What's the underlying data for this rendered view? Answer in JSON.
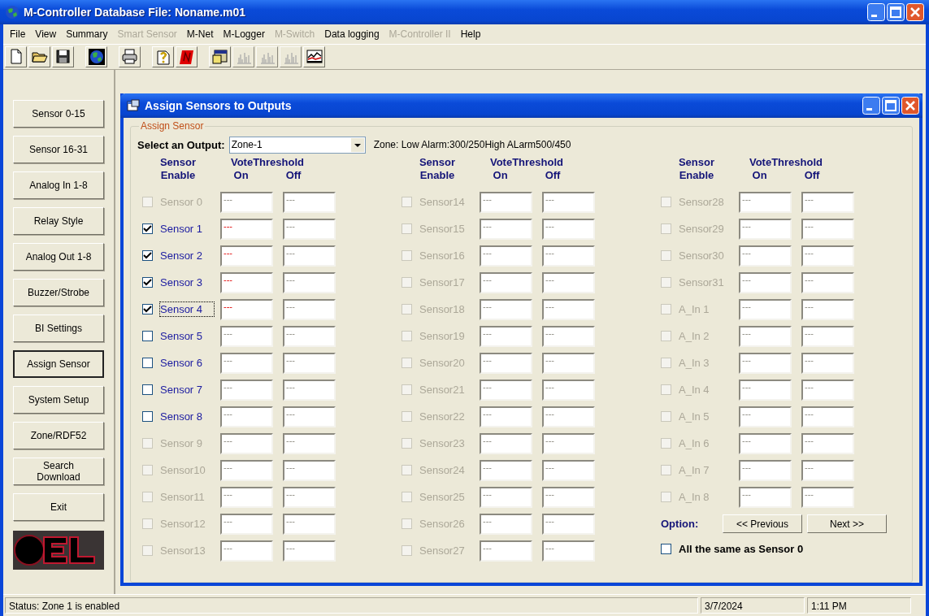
{
  "window": {
    "title": "M-Controller Database File: Noname.m01"
  },
  "menu": [
    {
      "label": "File",
      "disabled": false
    },
    {
      "label": "View",
      "disabled": false
    },
    {
      "label": "Summary",
      "disabled": false
    },
    {
      "label": "Smart Sensor",
      "disabled": true
    },
    {
      "label": "M-Net",
      "disabled": false
    },
    {
      "label": "M-Logger",
      "disabled": false
    },
    {
      "label": "M-Switch",
      "disabled": true
    },
    {
      "label": "Data logging",
      "disabled": false
    },
    {
      "label": "M-Controller II",
      "disabled": true
    },
    {
      "label": "Help",
      "disabled": false
    }
  ],
  "toolbar": [
    {
      "buttons": [
        {
          "kind": "new",
          "disabled": false
        },
        {
          "kind": "open",
          "disabled": false
        },
        {
          "kind": "save",
          "disabled": false
        }
      ]
    },
    {
      "buttons": [
        {
          "kind": "globe",
          "disabled": false
        }
      ]
    },
    {
      "buttons": [
        {
          "kind": "print",
          "disabled": false
        }
      ]
    },
    {
      "buttons": [
        {
          "kind": "help",
          "disabled": false
        },
        {
          "kind": "stop",
          "disabled": false
        }
      ]
    },
    {
      "buttons": [
        {
          "kind": "window",
          "disabled": false
        },
        {
          "kind": "bars",
          "disabled": true
        },
        {
          "kind": "bars",
          "disabled": true
        },
        {
          "kind": "bars",
          "disabled": true
        },
        {
          "kind": "trend",
          "disabled": false
        }
      ]
    }
  ],
  "sidebar": {
    "buttons": [
      {
        "label": "Sensor 0-15",
        "selected": false
      },
      {
        "label": "Sensor 16-31",
        "selected": false
      },
      {
        "label": "Analog In 1-8",
        "selected": false
      },
      {
        "label": "Relay Style",
        "selected": false
      },
      {
        "label": "Analog Out 1-8",
        "selected": false
      },
      {
        "label": "Buzzer/Strobe",
        "selected": false
      },
      {
        "label": "BI Settings",
        "selected": false
      },
      {
        "label": "Assign Sensor",
        "selected": true
      },
      {
        "label": "System Setup",
        "selected": false
      },
      {
        "label": "Zone/RDF52",
        "selected": false
      },
      {
        "label": "Search Download",
        "selected": false
      },
      {
        "label": "Exit",
        "selected": false
      }
    ]
  },
  "dialog": {
    "title": "Assign Sensors to Outputs",
    "group_label": "Assign Sensor",
    "output_label": "Select an Output:",
    "output_value": "Zone-1",
    "zone_info": "Zone: Low Alarm:300/250High ALarm500/450",
    "columns": [
      {
        "header": {
          "sensor": "Sensor",
          "enable": "Enable",
          "vote": "VoteThreshold",
          "on": "On",
          "off": "Off"
        },
        "sensors": [
          {
            "label": "Sensor 0",
            "enabled": false,
            "checked": false,
            "focused": false,
            "on": "---",
            "on_alert": false,
            "off": "---"
          },
          {
            "label": "Sensor 1",
            "enabled": true,
            "checked": true,
            "focused": false,
            "on": "---",
            "on_alert": true,
            "off": "---"
          },
          {
            "label": "Sensor 2",
            "enabled": true,
            "checked": true,
            "focused": false,
            "on": "---",
            "on_alert": true,
            "off": "---"
          },
          {
            "label": "Sensor 3",
            "enabled": true,
            "checked": true,
            "focused": false,
            "on": "---",
            "on_alert": true,
            "off": "---"
          },
          {
            "label": "Sensor 4",
            "enabled": true,
            "checked": true,
            "focused": true,
            "on": "---",
            "on_alert": true,
            "off": "---"
          },
          {
            "label": "Sensor 5",
            "enabled": true,
            "checked": false,
            "focused": false,
            "on": "---",
            "on_alert": false,
            "off": "---"
          },
          {
            "label": "Sensor 6",
            "enabled": true,
            "checked": false,
            "focused": false,
            "on": "---",
            "on_alert": false,
            "off": "---"
          },
          {
            "label": "Sensor 7",
            "enabled": true,
            "checked": false,
            "focused": false,
            "on": "---",
            "on_alert": false,
            "off": "---"
          },
          {
            "label": "Sensor 8",
            "enabled": true,
            "checked": false,
            "focused": false,
            "on": "---",
            "on_alert": false,
            "off": "---"
          },
          {
            "label": "Sensor 9",
            "enabled": false,
            "checked": false,
            "focused": false,
            "on": "---",
            "on_alert": false,
            "off": "---"
          },
          {
            "label": "Sensor10",
            "enabled": false,
            "checked": false,
            "focused": false,
            "on": "---",
            "on_alert": false,
            "off": "---"
          },
          {
            "label": "Sensor11",
            "enabled": false,
            "checked": false,
            "focused": false,
            "on": "---",
            "on_alert": false,
            "off": "---"
          },
          {
            "label": "Sensor12",
            "enabled": false,
            "checked": false,
            "focused": false,
            "on": "---",
            "on_alert": false,
            "off": "---"
          },
          {
            "label": "Sensor13",
            "enabled": false,
            "checked": false,
            "focused": false,
            "on": "---",
            "on_alert": false,
            "off": "---"
          }
        ]
      },
      {
        "header": {
          "sensor": "Sensor",
          "enable": "Enable",
          "vote": "VoteThreshold",
          "on": "On",
          "off": "Off"
        },
        "sensors": [
          {
            "label": "Sensor14",
            "enabled": false,
            "checked": false,
            "focused": false,
            "on": "---",
            "on_alert": false,
            "off": "---"
          },
          {
            "label": "Sensor15",
            "enabled": false,
            "checked": false,
            "focused": false,
            "on": "---",
            "on_alert": false,
            "off": "---"
          },
          {
            "label": "Sensor16",
            "enabled": false,
            "checked": false,
            "focused": false,
            "on": "---",
            "on_alert": false,
            "off": "---"
          },
          {
            "label": "Sensor17",
            "enabled": false,
            "checked": false,
            "focused": false,
            "on": "---",
            "on_alert": false,
            "off": "---"
          },
          {
            "label": "Sensor18",
            "enabled": false,
            "checked": false,
            "focused": false,
            "on": "---",
            "on_alert": false,
            "off": "---"
          },
          {
            "label": "Sensor19",
            "enabled": false,
            "checked": false,
            "focused": false,
            "on": "---",
            "on_alert": false,
            "off": "---"
          },
          {
            "label": "Sensor20",
            "enabled": false,
            "checked": false,
            "focused": false,
            "on": "---",
            "on_alert": false,
            "off": "---"
          },
          {
            "label": "Sensor21",
            "enabled": false,
            "checked": false,
            "focused": false,
            "on": "---",
            "on_alert": false,
            "off": "---"
          },
          {
            "label": "Sensor22",
            "enabled": false,
            "checked": false,
            "focused": false,
            "on": "---",
            "on_alert": false,
            "off": "---"
          },
          {
            "label": "Sensor23",
            "enabled": false,
            "checked": false,
            "focused": false,
            "on": "---",
            "on_alert": false,
            "off": "---"
          },
          {
            "label": "Sensor24",
            "enabled": false,
            "checked": false,
            "focused": false,
            "on": "---",
            "on_alert": false,
            "off": "---"
          },
          {
            "label": "Sensor25",
            "enabled": false,
            "checked": false,
            "focused": false,
            "on": "---",
            "on_alert": false,
            "off": "---"
          },
          {
            "label": "Sensor26",
            "enabled": false,
            "checked": false,
            "focused": false,
            "on": "---",
            "on_alert": false,
            "off": "---"
          },
          {
            "label": "Sensor27",
            "enabled": false,
            "checked": false,
            "focused": false,
            "on": "---",
            "on_alert": false,
            "off": "---"
          }
        ]
      },
      {
        "header": {
          "sensor": "Sensor",
          "enable": "Enable",
          "vote": "VoteThreshold",
          "on": "On",
          "off": "Off"
        },
        "sensors": [
          {
            "label": "Sensor28",
            "enabled": false,
            "checked": false,
            "focused": false,
            "on": "---",
            "on_alert": false,
            "off": "---"
          },
          {
            "label": "Sensor29",
            "enabled": false,
            "checked": false,
            "focused": false,
            "on": "---",
            "on_alert": false,
            "off": "---"
          },
          {
            "label": "Sensor30",
            "enabled": false,
            "checked": false,
            "focused": false,
            "on": "---",
            "on_alert": false,
            "off": "---"
          },
          {
            "label": "Sensor31",
            "enabled": false,
            "checked": false,
            "focused": false,
            "on": "---",
            "on_alert": false,
            "off": "---"
          },
          {
            "label": "A_In 1",
            "enabled": false,
            "checked": false,
            "focused": false,
            "on": "---",
            "on_alert": false,
            "off": "---"
          },
          {
            "label": "A_In 2",
            "enabled": false,
            "checked": false,
            "focused": false,
            "on": "---",
            "on_alert": false,
            "off": "---"
          },
          {
            "label": "A_In 3",
            "enabled": false,
            "checked": false,
            "focused": false,
            "on": "---",
            "on_alert": false,
            "off": "---"
          },
          {
            "label": "A_In 4",
            "enabled": false,
            "checked": false,
            "focused": false,
            "on": "---",
            "on_alert": false,
            "off": "---"
          },
          {
            "label": "A_In 5",
            "enabled": false,
            "checked": false,
            "focused": false,
            "on": "---",
            "on_alert": false,
            "off": "---"
          },
          {
            "label": "A_In 6",
            "enabled": false,
            "checked": false,
            "focused": false,
            "on": "---",
            "on_alert": false,
            "off": "---"
          },
          {
            "label": "A_In 7",
            "enabled": false,
            "checked": false,
            "focused": false,
            "on": "---",
            "on_alert": false,
            "off": "---"
          },
          {
            "label": "A_In 8",
            "enabled": false,
            "checked": false,
            "focused": false,
            "on": "---",
            "on_alert": false,
            "off": "---"
          }
        ]
      }
    ],
    "option_label": "Option:",
    "buttons": [
      "<< Previous",
      "Next >>"
    ],
    "same_as": {
      "label": "All the same as Sensor 0",
      "checked": false
    }
  },
  "status_bar": {
    "status": "Status: Zone 1 is enabled",
    "date": "3/7/2024",
    "time": "1:11 PM"
  }
}
